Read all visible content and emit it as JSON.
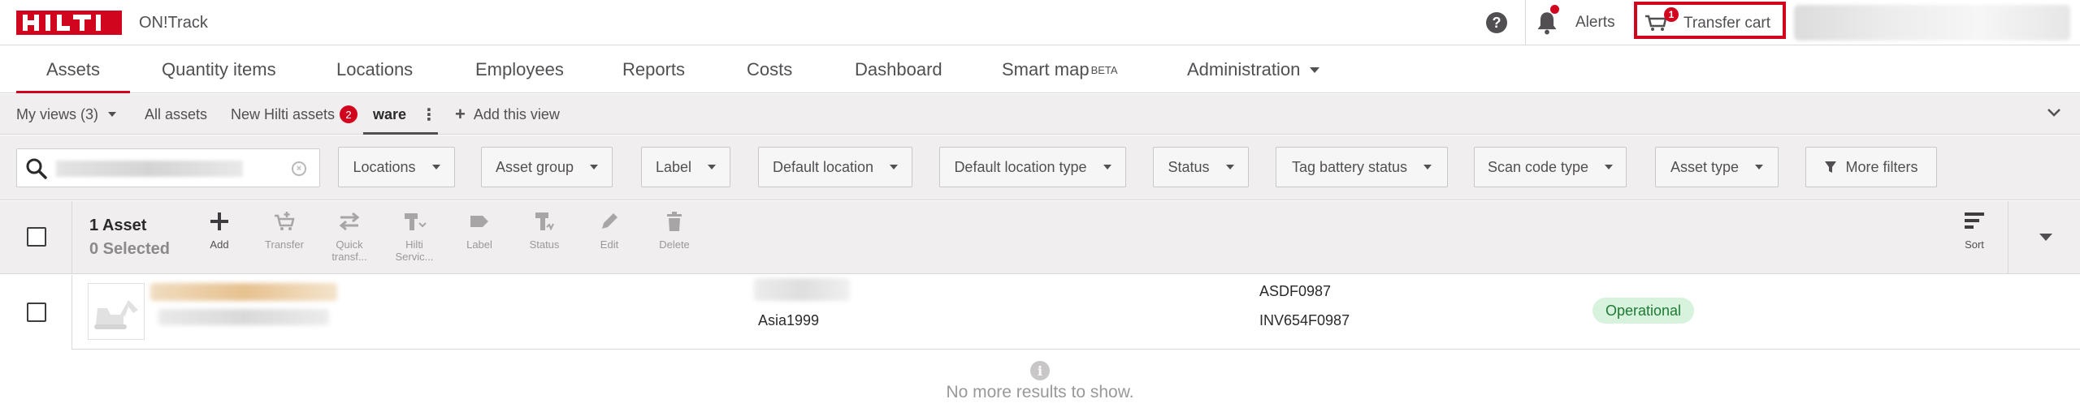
{
  "header": {
    "logo_text": "HILTI",
    "product_name": "ON!Track",
    "alerts_label": "Alerts",
    "cart_label": "Transfer cart",
    "cart_count": "1",
    "help_glyph": "?"
  },
  "tabs": [
    {
      "label": "Assets",
      "active": true
    },
    {
      "label": "Quantity items"
    },
    {
      "label": "Locations"
    },
    {
      "label": "Employees"
    },
    {
      "label": "Reports"
    },
    {
      "label": "Costs"
    },
    {
      "label": "Dashboard"
    },
    {
      "label": "Smart map",
      "sup": "BETA"
    },
    {
      "label": "Administration"
    }
  ],
  "views": {
    "my_views": "My views (3)",
    "all_assets": "All assets",
    "new_hilti_assets": "New Hilti assets",
    "new_hilti_count": "2",
    "current_view": "ware",
    "add_view": "Add this view"
  },
  "search": {
    "placeholder": "",
    "clear_glyph": "×"
  },
  "filters": [
    "Locations",
    "Asset group",
    "Label",
    "Default location",
    "Default location type",
    "Status",
    "Tag battery status",
    "Scan code type",
    "Asset type",
    "More filters"
  ],
  "action_bar": {
    "asset_count": "1 Asset",
    "selected_count": "0 Selected",
    "actions": [
      {
        "label": "Add",
        "icon": "plus-icon",
        "enabled": true
      },
      {
        "label": "Transfer",
        "icon": "transfer-cart-icon",
        "enabled": false
      },
      {
        "label": "Quick transf...",
        "icon": "quick-transfer-icon",
        "enabled": false
      },
      {
        "label": "Hilti Servic...",
        "icon": "hilti-service-icon",
        "enabled": false
      },
      {
        "label": "Label",
        "icon": "label-tag-icon",
        "enabled": false
      },
      {
        "label": "Status",
        "icon": "status-tool-icon",
        "enabled": false
      },
      {
        "label": "Edit",
        "icon": "pencil-icon",
        "enabled": false
      },
      {
        "label": "Delete",
        "icon": "trash-icon",
        "enabled": false
      }
    ],
    "sort_label": "Sort"
  },
  "rows": [
    {
      "location": "Asia1999",
      "scan_code": "ASDF0987",
      "inventory_number": "INV654F0987",
      "status": "Operational"
    }
  ],
  "footer": {
    "info_glyph": "i",
    "no_more_results": "No more results to show."
  },
  "colors": {
    "brand_red": "#d2051e",
    "status_green_bg": "#d7f3dd",
    "status_green_text": "#1e7a32",
    "toolbar_bg": "#f0eeee"
  }
}
